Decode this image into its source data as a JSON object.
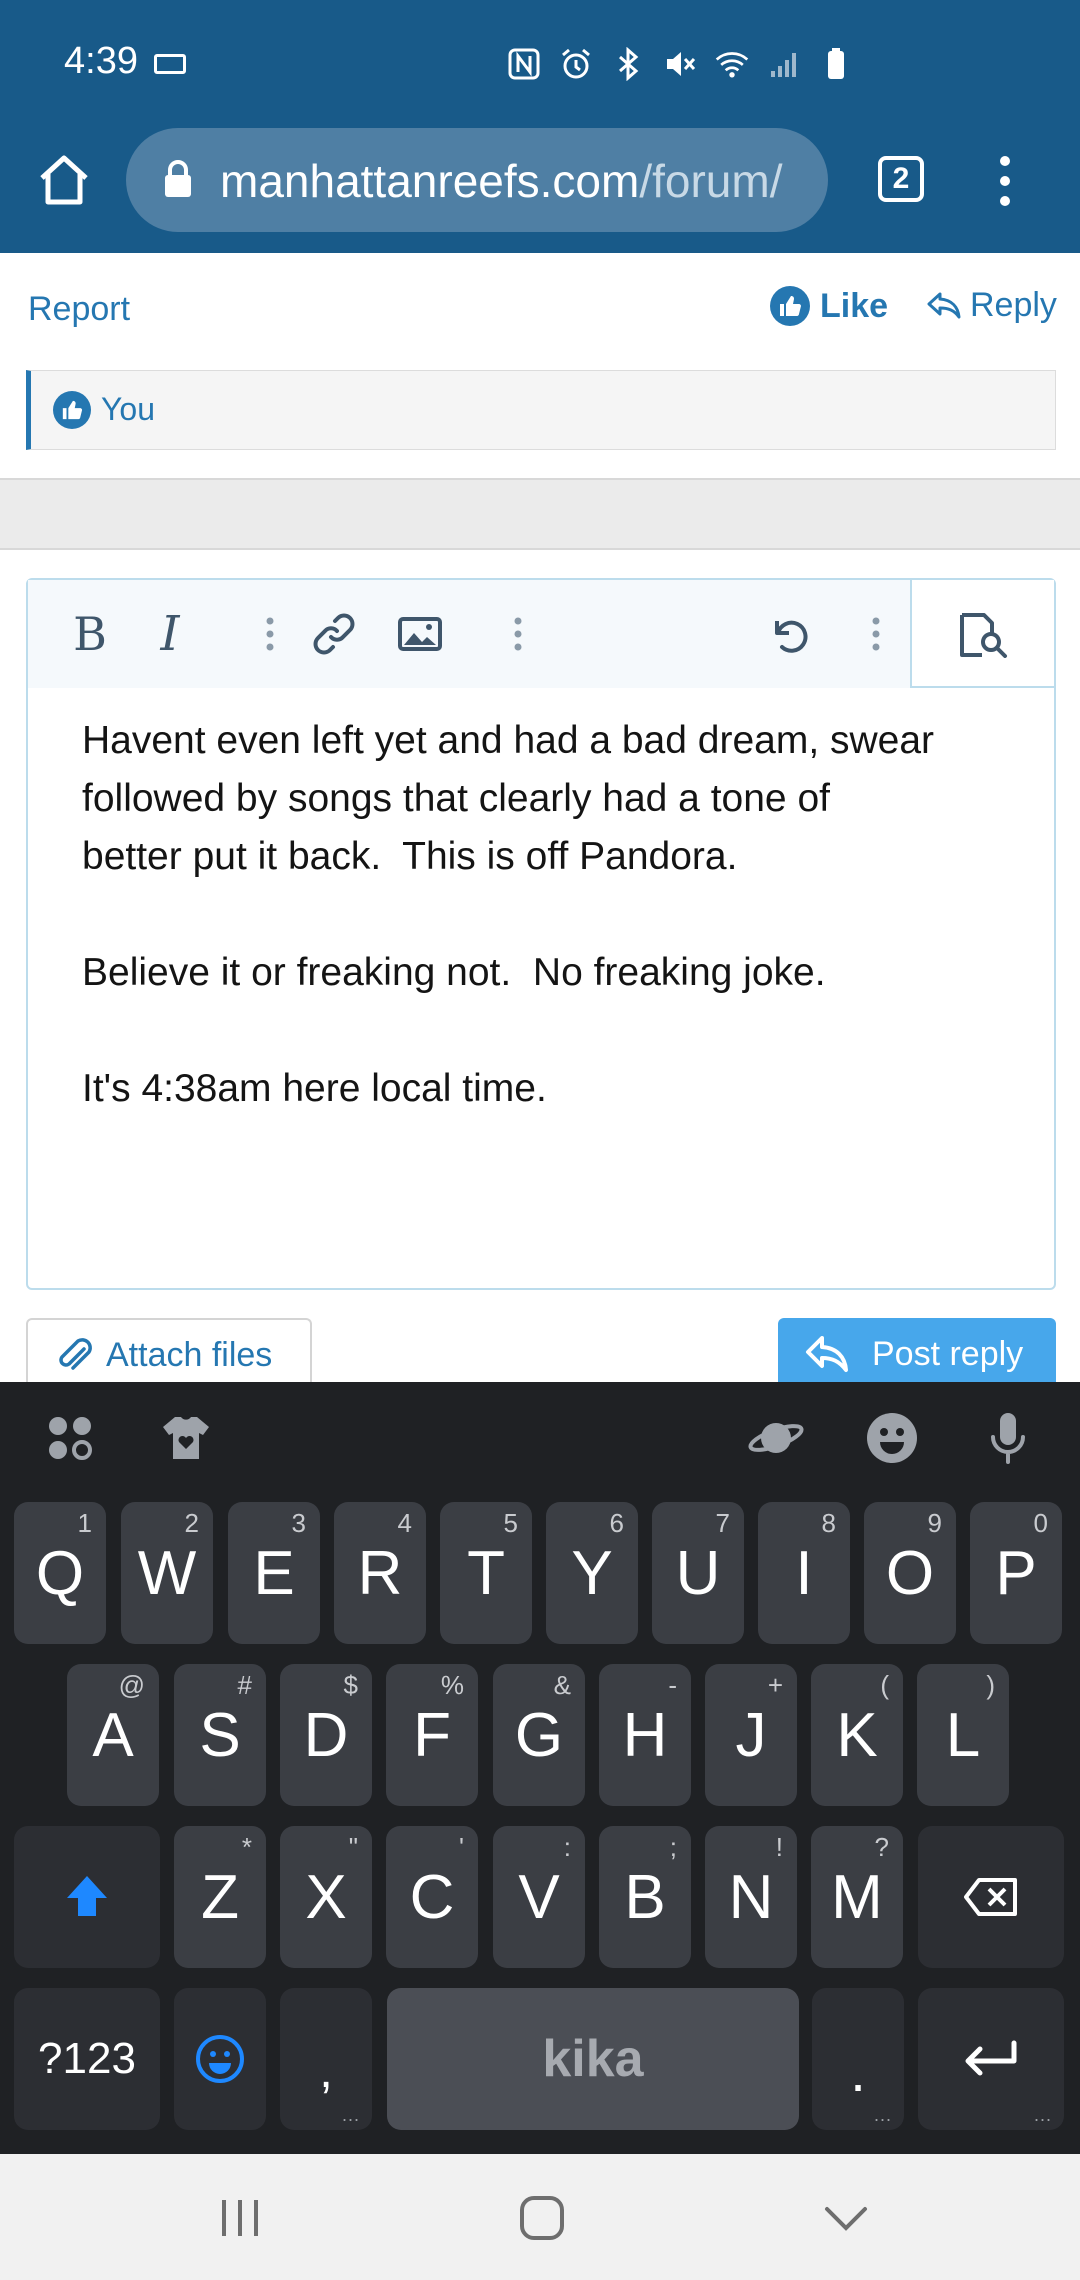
{
  "status_bar": {
    "time": "4:39",
    "icons": [
      "nfc-icon",
      "alarm-icon",
      "bluetooth-icon",
      "mute-icon",
      "wifi-icon",
      "signal-icon",
      "battery-icon"
    ]
  },
  "browser": {
    "url_domain": "manhattanreefs.com",
    "url_path": "/forum/",
    "tab_count": "2"
  },
  "post_actions": {
    "report": "Report",
    "like": "Like",
    "reply": "Reply"
  },
  "likes": {
    "text": "You"
  },
  "editor": {
    "paragraphs": [
      "Havent even left yet and had a bad dream, swear",
      "followed by songs that clearly had a tone of",
      "better put it back.  This is off Pandora.",
      "Believe it or freaking not.  No freaking joke.",
      "It's 4:38am here local time."
    ]
  },
  "buttons": {
    "attach_files": "Attach files",
    "post_reply": "Post reply"
  },
  "keyboard": {
    "row1": [
      {
        "key": "Q",
        "hint": "1"
      },
      {
        "key": "W",
        "hint": "2"
      },
      {
        "key": "E",
        "hint": "3"
      },
      {
        "key": "R",
        "hint": "4"
      },
      {
        "key": "T",
        "hint": "5"
      },
      {
        "key": "Y",
        "hint": "6"
      },
      {
        "key": "U",
        "hint": "7"
      },
      {
        "key": "I",
        "hint": "8"
      },
      {
        "key": "O",
        "hint": "9"
      },
      {
        "key": "P",
        "hint": "0"
      }
    ],
    "row2": [
      {
        "key": "A",
        "hint": "@"
      },
      {
        "key": "S",
        "hint": "#"
      },
      {
        "key": "D",
        "hint": "$"
      },
      {
        "key": "F",
        "hint": "%"
      },
      {
        "key": "G",
        "hint": "&"
      },
      {
        "key": "H",
        "hint": "-"
      },
      {
        "key": "J",
        "hint": "+"
      },
      {
        "key": "K",
        "hint": "("
      },
      {
        "key": "L",
        "hint": ")"
      }
    ],
    "row3": [
      {
        "key": "Z",
        "hint": "*"
      },
      {
        "key": "X",
        "hint": "\""
      },
      {
        "key": "C",
        "hint": "'"
      },
      {
        "key": "V",
        "hint": ":"
      },
      {
        "key": "B",
        "hint": ";"
      },
      {
        "key": "N",
        "hint": "!"
      },
      {
        "key": "M",
        "hint": "?"
      }
    ],
    "symbols_key": "?123",
    "comma_key": ",",
    "space_key": "kika",
    "period_key": ".",
    "accent_color": "#1e88ff"
  }
}
